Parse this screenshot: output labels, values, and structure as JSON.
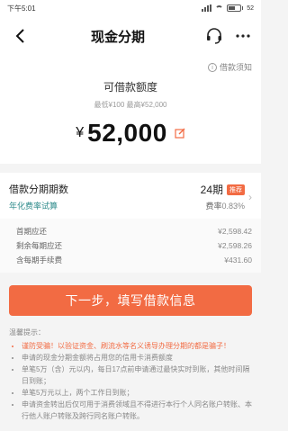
{
  "status": {
    "time": "下午5:01",
    "battery": "52"
  },
  "nav": {
    "title": "现金分期"
  },
  "quota": {
    "help_link": "借款须知",
    "label": "可借款额度",
    "range": "最低¥100  最高¥52,000",
    "currency": "¥",
    "amount": "52,000"
  },
  "installments": {
    "label": "借款分期期数",
    "sub_link": "年化费率试算",
    "periods": "24期",
    "badge": "推荐",
    "rate_label": "费率",
    "rate_value": "0.83%"
  },
  "fees": [
    {
      "label": "首期应还",
      "value": "¥2,598.42"
    },
    {
      "label": "剩余每期应还",
      "value": "¥2,598.26"
    },
    {
      "label": "含每期手续费",
      "value": "¥431.60"
    }
  ],
  "cta": {
    "label": "下一步，填写借款信息"
  },
  "tips": {
    "title": "温馨提示：",
    "items": [
      "谨防受骗！以验证资金、刷流水等名义诱导办理分期的都是骗子！",
      "申请的现金分期金额将占用您的信用卡消费额度",
      "单笔5万（含）元以内，每日17点前申请通过最快实时到账，其他时间隔日到账；",
      "单笔5万元以上，两个工作日到账；",
      "申请资金转出后仅可用于消费领域且不得进行本行个人同名账户转账、本行他人账户转账及跨行同名账户转账。"
    ]
  },
  "colors": {
    "accent": "#f26b43",
    "link": "#2e8b8b"
  }
}
